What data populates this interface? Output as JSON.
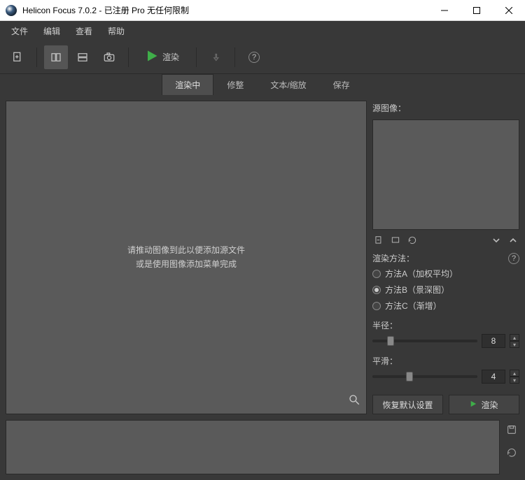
{
  "window": {
    "title": "Helicon Focus 7.0.2 - 已注册 Pro 无任何限制"
  },
  "menu": {
    "file": "文件",
    "edit": "编辑",
    "view": "查看",
    "help": "帮助"
  },
  "toolbar": {
    "render": "渲染"
  },
  "tabs": {
    "rendering": "渲染中",
    "retouch": "修整",
    "textscale": "文本/缩放",
    "save": "保存"
  },
  "canvas": {
    "placeholder_line1": "请推动图像到此以便添加源文件",
    "placeholder_line2": "或是使用图像添加菜单完成"
  },
  "side": {
    "source_label": "源图像：",
    "method_label": "渲染方法：",
    "method_a": "方法A（加权平均）",
    "method_b": "方法B（景深图）",
    "method_c": "方法C（渐增）",
    "radius_label": "半径：",
    "radius_value": "8",
    "smoothing_label": "平滑：",
    "smoothing_value": "4",
    "reset": "恢复默认设置",
    "render": "渲染"
  }
}
